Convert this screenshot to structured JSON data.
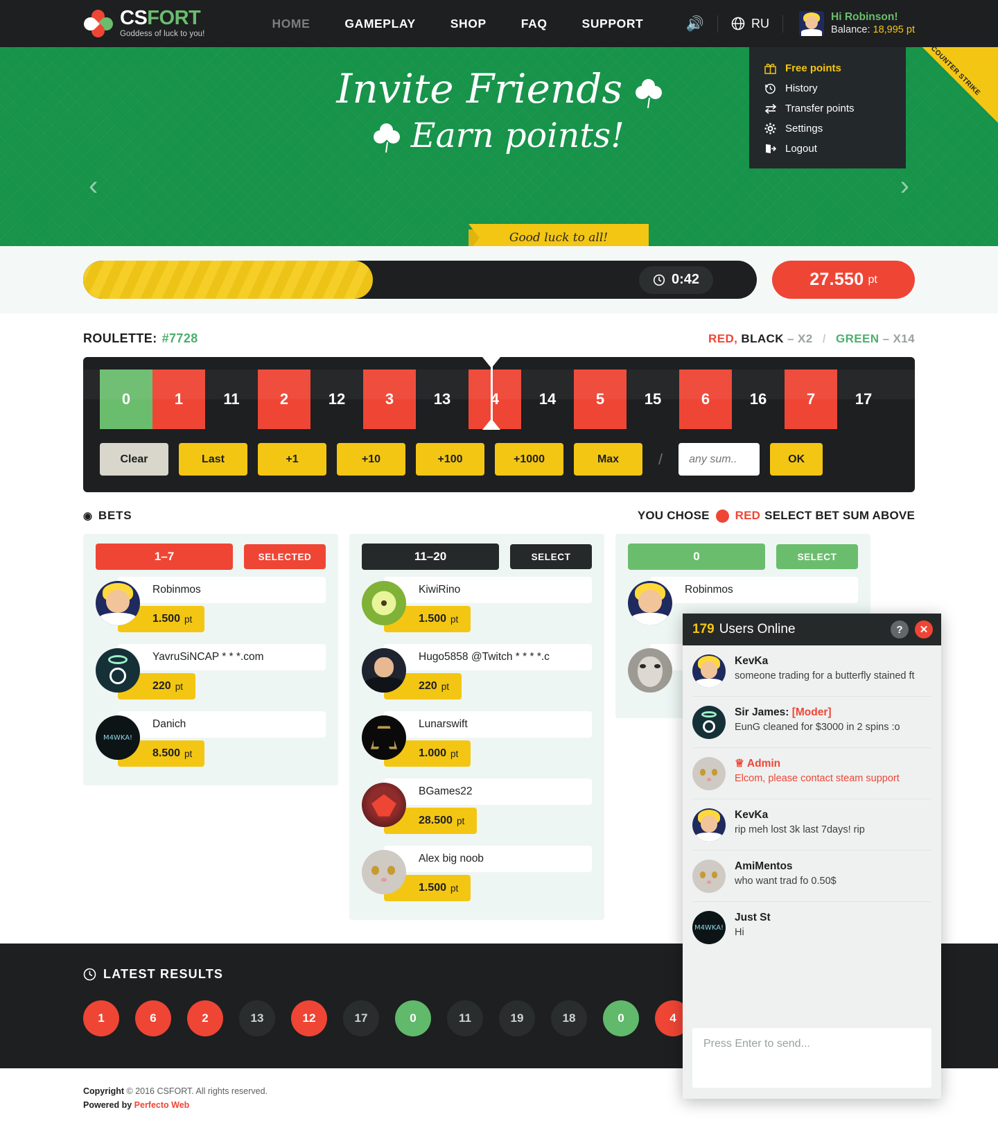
{
  "header": {
    "logo_name_1": "CS",
    "logo_name_2": "FORT",
    "logo_tagline": "Goddess of luck to you!",
    "nav": [
      {
        "label": "HOME",
        "active": false
      },
      {
        "label": "GAMEPLAY",
        "active": true
      },
      {
        "label": "SHOP",
        "active": true
      },
      {
        "label": "FAQ",
        "active": true
      },
      {
        "label": "SUPPORT",
        "active": true
      }
    ],
    "lang": "RU",
    "greeting": "Hi Robinson!",
    "balance_label": "Balance:",
    "balance_value": "18,995 pt"
  },
  "dropdown": {
    "items": [
      {
        "label": "Free points",
        "icon": "gift-icon",
        "active": true
      },
      {
        "label": "History",
        "icon": "history-icon",
        "active": false
      },
      {
        "label": "Transfer points",
        "icon": "transfer-icon",
        "active": false
      },
      {
        "label": "Settings",
        "icon": "gear-icon",
        "active": false
      },
      {
        "label": "Logout",
        "icon": "logout-icon",
        "active": false
      }
    ]
  },
  "banner": {
    "line1": "Invite Friends",
    "line2": "Earn points!",
    "ribbon": "Good luck to all!",
    "corner_badge": "COUNTER STRIKE"
  },
  "progress": {
    "fill_percent": 43,
    "timer": "0:42",
    "pot_value": "27.550",
    "pot_unit": "pt"
  },
  "roulette": {
    "label": "ROULETTE:",
    "round_id": "#7728",
    "odds_red": "RED,",
    "odds_black": "BLACK",
    "odds_x2": "– X2",
    "odds_sep": "/",
    "odds_green": "GREEN",
    "odds_x14": "– X14",
    "cells": [
      {
        "n": "0",
        "color": "green"
      },
      {
        "n": "1",
        "color": "red"
      },
      {
        "n": "11",
        "color": "black"
      },
      {
        "n": "2",
        "color": "red"
      },
      {
        "n": "12",
        "color": "black"
      },
      {
        "n": "3",
        "color": "red"
      },
      {
        "n": "13",
        "color": "black"
      },
      {
        "n": "4",
        "color": "red"
      },
      {
        "n": "14",
        "color": "black"
      },
      {
        "n": "5",
        "color": "red"
      },
      {
        "n": "15",
        "color": "black"
      },
      {
        "n": "6",
        "color": "red"
      },
      {
        "n": "16",
        "color": "black"
      },
      {
        "n": "7",
        "color": "red"
      },
      {
        "n": "17",
        "color": "black"
      }
    ],
    "controls": {
      "clear": "Clear",
      "last": "Last",
      "p1": "+1",
      "p10": "+10",
      "p100": "+100",
      "p1000": "+1000",
      "max": "Max",
      "slash": "/",
      "sum_placeholder": "any sum..",
      "sum_value": "",
      "ok": "OK"
    }
  },
  "bets": {
    "title": "BETS",
    "chose_prefix": "YOU CHOSE",
    "chose_color": "RED",
    "chose_suffix": "SELECT BET SUM ABOVE",
    "columns": [
      {
        "range": "1–7",
        "theme": "red",
        "button": "SELECTED",
        "entries": [
          {
            "name": "Robinmos",
            "points": "1.500",
            "unit": "pt",
            "avatar": "blond"
          },
          {
            "name": "YavruSiNCAP * * *.com",
            "points": "220",
            "unit": "pt",
            "avatar": "dark"
          },
          {
            "name": "Danich",
            "points": "8.500",
            "unit": "pt",
            "avatar": "mwk"
          }
        ]
      },
      {
        "range": "11–20",
        "theme": "black",
        "button": "SELECT",
        "entries": [
          {
            "name": "KiwiRino",
            "points": "1.500",
            "unit": "pt",
            "avatar": "kiwi"
          },
          {
            "name": "Hugo5858 @Twitch * * * *.c",
            "points": "220",
            "unit": "pt",
            "avatar": "hugo"
          },
          {
            "name": "Lunarswift",
            "points": "1.000",
            "unit": "pt",
            "avatar": "luna"
          },
          {
            "name": "BGames22",
            "points": "28.500",
            "unit": "pt",
            "avatar": "bg"
          },
          {
            "name": "Alex big noob",
            "points": "1.500",
            "unit": "pt",
            "avatar": "cat"
          }
        ]
      },
      {
        "range": "0",
        "theme": "green",
        "button": "SELECT",
        "entries": [
          {
            "name": "Robinmos",
            "points": "",
            "unit": "",
            "avatar": "blond"
          },
          {
            "name": "",
            "points": "",
            "unit": "",
            "avatar": "goat"
          }
        ]
      }
    ]
  },
  "latest_results": {
    "title": "LATEST RESULTS",
    "balls": [
      {
        "n": "1",
        "color": "red"
      },
      {
        "n": "6",
        "color": "red"
      },
      {
        "n": "2",
        "color": "red"
      },
      {
        "n": "13",
        "color": "black"
      },
      {
        "n": "12",
        "color": "red"
      },
      {
        "n": "17",
        "color": "black"
      },
      {
        "n": "0",
        "color": "green"
      },
      {
        "n": "11",
        "color": "black"
      },
      {
        "n": "19",
        "color": "black"
      },
      {
        "n": "18",
        "color": "black"
      },
      {
        "n": "0",
        "color": "green"
      },
      {
        "n": "4",
        "color": "red"
      }
    ]
  },
  "chat": {
    "online_count": "179",
    "online_label": "Users Online",
    "help_glyph": "?",
    "close_glyph": "✕",
    "input_placeholder": "Press Enter to send...",
    "messages": [
      {
        "user": "KevKa",
        "role": "",
        "text": "someone trading for a butterfly stained ft",
        "avatar": "blond",
        "admin": false
      },
      {
        "user": "Sir James:",
        "role": "[Moder]",
        "text": "EunG cleaned for $3000 in 2 spins :o",
        "avatar": "dark",
        "admin": false
      },
      {
        "user": "Admin",
        "role": "",
        "text": "Elcom, please contact steam support",
        "avatar": "cat",
        "admin": true
      },
      {
        "user": "KevKa",
        "role": "",
        "text": "rip meh lost 3k last 7days! rip",
        "avatar": "blond",
        "admin": false
      },
      {
        "user": "AmiMentos",
        "role": "",
        "text": "who want trad fo 0.50$",
        "avatar": "cat",
        "admin": false
      },
      {
        "user": "Just St",
        "role": "",
        "text": "Hi",
        "avatar": "mwk",
        "admin": false
      }
    ]
  },
  "footer": {
    "copyright_prefix": "Copyright",
    "copyright": "© 2016 CSFORT. All rights reserved.",
    "powered_prefix": "Powered by",
    "powered_by": "Perfecto Web"
  }
}
